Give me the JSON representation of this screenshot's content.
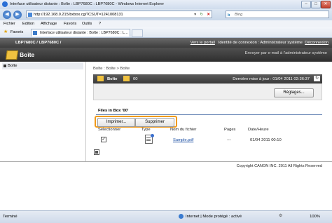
{
  "window": {
    "title": "Interface utilisateur distante : Boîte : LBP7680C : LBP7680C - Windows Internet Explorer",
    "minimize": "–",
    "maximize": "□",
    "close": "✕"
  },
  "addressbar": {
    "back": "◀",
    "forward": "▶",
    "url": "http://192.168.0.215/bxbox.cgi?CSUT=1241008131",
    "dropdown": "▾",
    "refresh": "↻",
    "stop": "✕",
    "search_placeholder": "Bing",
    "search_brand": "b"
  },
  "menu": {
    "items": [
      "Fichier",
      "Edition",
      "Affichage",
      "Favoris",
      "Outils",
      "?"
    ]
  },
  "favorites": {
    "label": "Favoris",
    "tab_title": "Interface utilisateur distante : Boîte : LBP7680C : L..."
  },
  "header": {
    "model": "LBP7680C / LBP7680C /",
    "portal_link": "Vers le portail",
    "login_label": "Identité de connexion : Administrateur système",
    "logout": "Déconnexion"
  },
  "page": {
    "title": "Boîte",
    "email_link": "Envoyer par e-mail à l'administrateur système"
  },
  "sidebar": {
    "items": [
      {
        "label": "Boîte"
      }
    ]
  },
  "main": {
    "breadcrumb": "Boîte : Boîte > Boîte",
    "box_label": "Boîte",
    "box_number": "00",
    "last_update": "Dernière mise à jour : 01/04 2011 02:36:37",
    "settings_button": "Réglages...",
    "files_title": "Files in Box '00'",
    "print_button": "Imprimer...",
    "delete_button": "Supprimer",
    "columns": [
      "Sélectionner",
      "Type",
      "Nom du fichier",
      "Pages",
      "Date/Heure"
    ],
    "rows": [
      {
        "selected": true,
        "check": "✓",
        "type_icon": "pdf-document-icon",
        "filename": "Sample.pdf",
        "pages": "---",
        "datetime": "01/04 2011 00:10"
      }
    ]
  },
  "footer": {
    "copyright": "Copyright CANON INC. 2011 All Rights Reserved"
  },
  "statusbar": {
    "status": "Terminé",
    "zone": "Internet | Mode protégé : activé",
    "zoom": "100%"
  },
  "colors": {
    "highlight": "#f09a1a",
    "link": "#1a4ea3",
    "header_dark": "#3c3c3c"
  }
}
